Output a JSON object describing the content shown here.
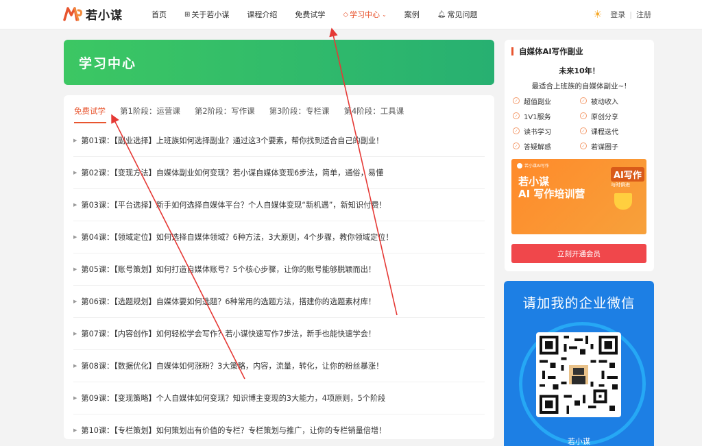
{
  "header": {
    "logo_text": "若小谋",
    "nav": [
      {
        "label": "首页"
      },
      {
        "label": "关于若小谋",
        "icon": "windows-icon"
      },
      {
        "label": "课程介绍"
      },
      {
        "label": "免费试学"
      },
      {
        "label": "学习中心",
        "icon": "diamond-icon",
        "active": true,
        "has_dropdown": true
      },
      {
        "label": "案例"
      },
      {
        "label": "常见问题",
        "icon": "bell-icon"
      }
    ],
    "login": "登录",
    "separator": "|",
    "register": "注册"
  },
  "banner": {
    "title": "学习中心"
  },
  "tabs": [
    {
      "label": "免费试学",
      "active": true
    },
    {
      "label": "第1阶段：运营课"
    },
    {
      "label": "第2阶段：写作课"
    },
    {
      "label": "第3阶段：专栏课"
    },
    {
      "label": "第4阶段：工具课"
    }
  ],
  "lessons": [
    "第01课：【副业选择】上班族如何选择副业？通过这3个要素，帮你找到适合自己的副业！",
    "第02课：【变现方法】自媒体副业如何变现？若小谋自媒体变现6步法，简单，通俗，易懂",
    "第03课：【平台选择】新手如何选择自媒体平台？个人自媒体变现“新机遇”，新知识付费！",
    "第04课：【领域定位】如何选择自媒体领域？6种方法，3大原则，4个步骤，教你领域定位！",
    "第05课：【账号策划】如何打造自媒体账号？5个核心步骤，让你的账号能够脱颖而出！",
    "第06课：【选题规划】自媒体要如何选题？6种常用的选题方法，搭建你的选题素材库！",
    "第07课：【内容创作】如何轻松学会写作？若小谋快速写作7步法，新手也能快速学会！",
    "第08课：【数据优化】自媒体如何涨粉？3大策略，内容，流量，转化，让你的粉丝暴涨！",
    "第09课：【变现策略】个人自媒体如何变现？知识博主变现的3大能力，4项原则，5个阶段",
    "第10课：【专栏策划】如何策划出有价值的专栏？专栏策划与推广，让你的专栏销量倍增！"
  ],
  "sidebar": {
    "heading": "自媒体AI写作副业",
    "line1": "未来10年！",
    "line2": "最适合上班族的自媒体副业~!",
    "features": [
      "超值副业",
      "被动收入",
      "1V1服务",
      "原创分享",
      "读书学习",
      "课程迭代",
      "答疑解惑",
      "若谋圈子"
    ],
    "promo": {
      "brand_small": "若小谋AI写作",
      "title1": "若小谋",
      "title2": "AI 写作培训营",
      "badge": "AI写作",
      "badge2": "与时俱进"
    },
    "cta": "立刻开通会员"
  },
  "wechat": {
    "title": "请加我的企业微信",
    "name": "若小谋"
  },
  "colors": {
    "accent": "#e8552f",
    "banner_green": "#3cc763",
    "cta_red": "#f0474b",
    "wechat_blue": "#1d7fe4",
    "arrow_red": "#e53935"
  }
}
